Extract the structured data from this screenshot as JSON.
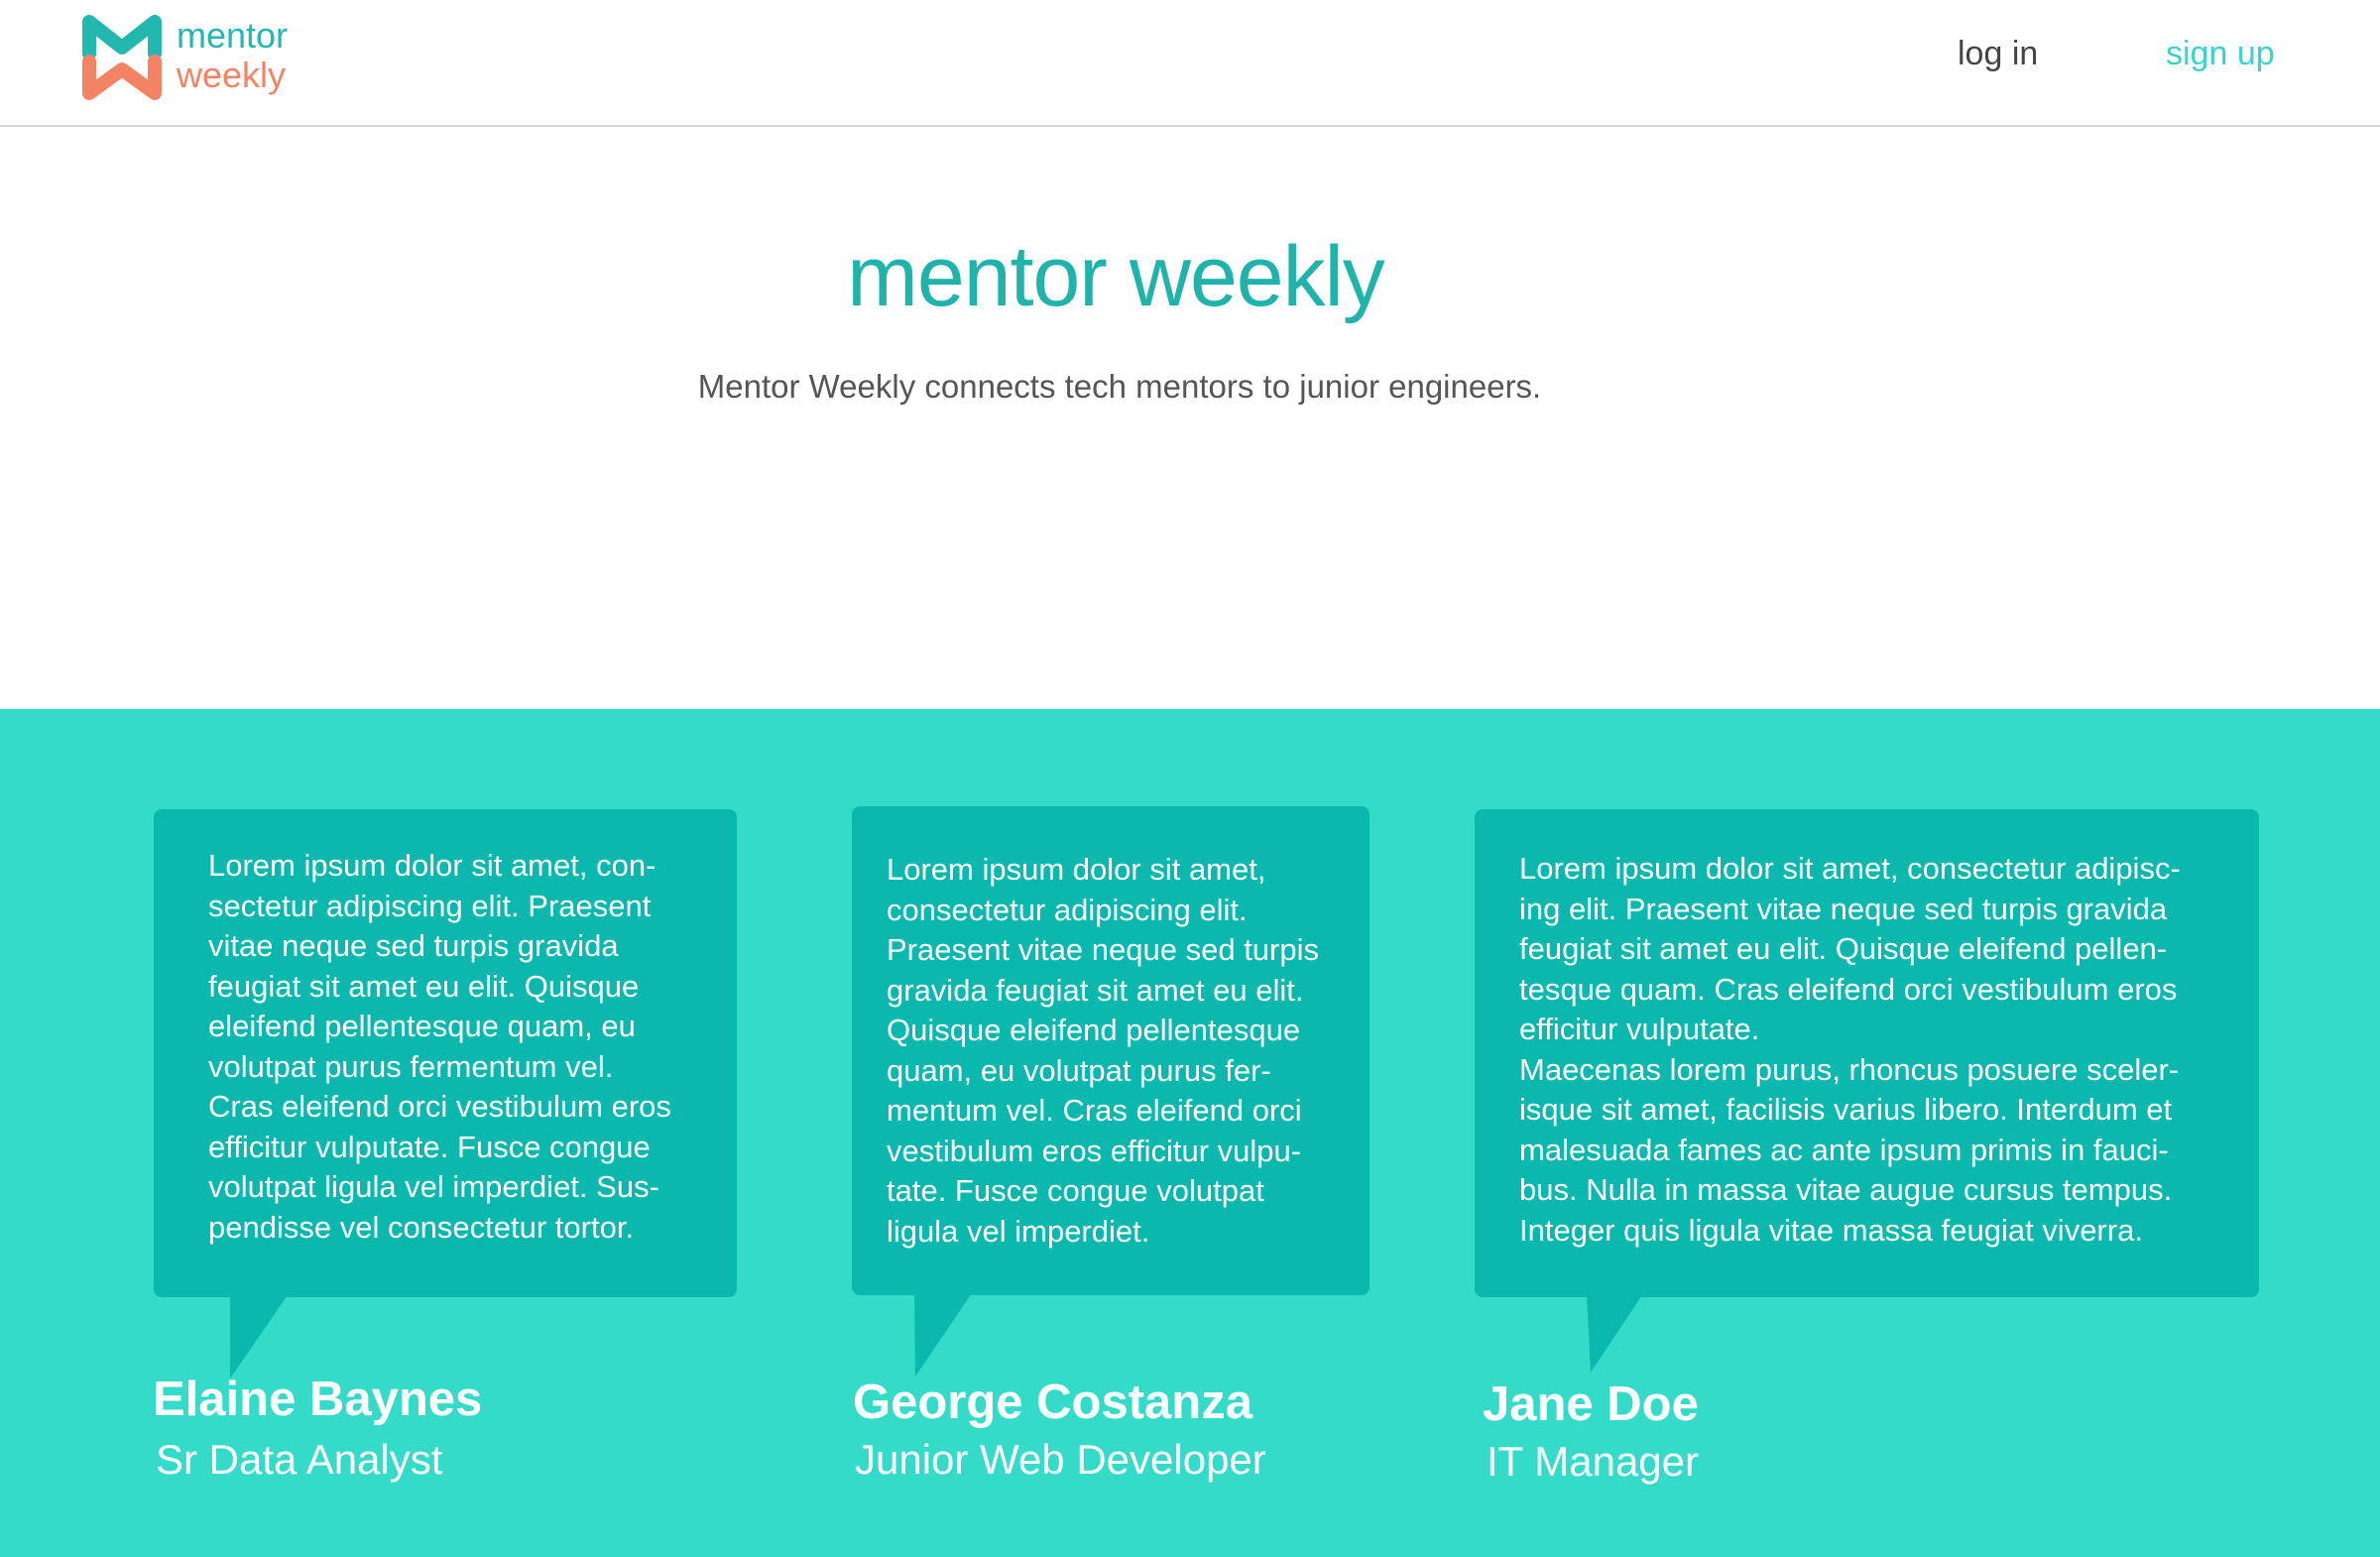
{
  "header": {
    "logo": {
      "line1": "mentor",
      "line2": "weekly",
      "icon": "mentor-weekly-mw-logo-icon",
      "colors": {
        "teal": "#22b8b0",
        "coral": "#f48364"
      }
    },
    "nav": {
      "login_label": "log in",
      "signup_label": "sign up"
    }
  },
  "hero": {
    "title": "mentor weekly",
    "subtitle": "Mentor Weekly connects tech mentors to junior engineers."
  },
  "testimonials": [
    {
      "quote": "Lorem ipsum dolor sit amet, con-\nsectetur adipiscing elit. Praesent\nvitae neque sed turpis gravida\nfeugiat sit amet eu elit. Quisque\neleifend pellentesque quam, eu\nvolutpat purus fermentum vel.\nCras eleifend orci vestibulum eros\nefficitur vulputate. Fusce congue\nvolutpat ligula vel imperdiet. Sus-\npendisse vel consectetur tortor.",
      "name": "Elaine Baynes",
      "role": "Sr Data Analyst"
    },
    {
      "quote": "Lorem ipsum dolor sit amet,\nconsectetur adipiscing elit.\nPraesent vitae neque sed turpis\ngravida feugiat sit amet eu elit.\nQuisque eleifend pellentesque\nquam, eu volutpat purus fer-\nmentum vel. Cras eleifend orci\nvestibulum eros efficitur vulpu-\ntate. Fusce congue volutpat\nligula vel imperdiet.",
      "name": "George Costanza",
      "role": "Junior Web Developer"
    },
    {
      "quote": "Lorem ipsum dolor sit amet, consectetur adipisc-\ning elit. Praesent vitae neque sed turpis gravida\nfeugiat sit amet eu elit. Quisque eleifend pellen-\ntesque quam. Cras eleifend orci vestibulum eros\nefficitur vulputate.\nMaecenas lorem purus, rhoncus posuere sceler-\nisque sit amet, facilisis varius libero. Interdum et\nmalesuada fames ac ante ipsum primis in fauci-\nbus.  Nulla in massa vitae augue cursus tempus.\nInteger quis ligula vitae massa feugiat viverra.",
      "name": "Jane Doe",
      "role": "IT Manager"
    }
  ],
  "colors": {
    "accent": "#20b3ab",
    "signup": "#37d5c8",
    "band": "#35dbc9",
    "bubble": "#0ab8ae"
  }
}
